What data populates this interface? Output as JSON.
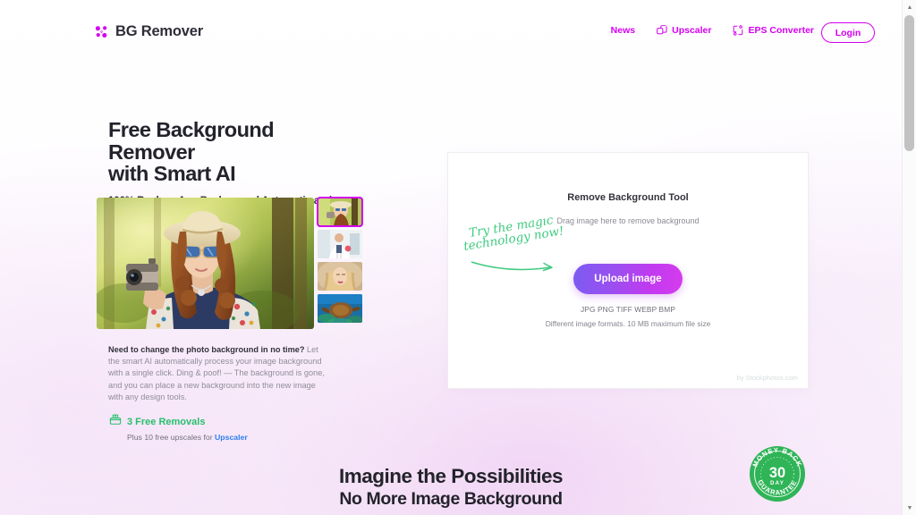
{
  "header": {
    "logo_text": "BG Remover",
    "logo_icon": "scissors-icon",
    "nav": [
      {
        "label": "News",
        "icon": ""
      },
      {
        "label": "Upscaler",
        "icon": "overlapping-squares-icon"
      },
      {
        "label": "EPS Converter",
        "icon": "nodes-icon"
      }
    ],
    "login_label": "Login"
  },
  "hero": {
    "title": "Free Background Remover\nwith Smart AI",
    "subtitle": "100% Replace Any Background Automatic and Free",
    "body_lead": "Need to change the photo background in no time?",
    "body_rest": " Let the smart AI automatically process your image background with a single click. Ding & poof! — The background is gone, and you can place a new background into the new image with any design tools.",
    "free_title": "3 Free Removals",
    "free_sub_prefix": "Plus 10 free upscales for ",
    "free_sub_link": "Upscaler",
    "thumbnails": [
      {
        "name": "thumbnail-woman-camera",
        "selected": true
      },
      {
        "name": "thumbnail-doctor",
        "selected": false
      },
      {
        "name": "thumbnail-blonde-portrait",
        "selected": false
      },
      {
        "name": "thumbnail-sea-turtle",
        "selected": false
      }
    ]
  },
  "upload_panel": {
    "annotation": "Try the magic technology now!",
    "title": "Remove Background Tool",
    "drag_text": "Drag image here to remove background",
    "button_label": "Upload image",
    "formats": "JPG PNG TIFF WEBP BMP",
    "note": "Different image formats. 10 MB maximum file size",
    "credit": "by Stockphotos.com"
  },
  "bottom": {
    "heading": "Imagine the Possibilities",
    "subheading": "No More Image Background",
    "badge": {
      "top_text": "MONEY BACK",
      "number": "30",
      "unit": "DAY",
      "bottom_text": "GUARANTEE"
    }
  },
  "colors": {
    "brand_magenta": "#d400f0",
    "green": "#27c06a",
    "link_blue": "#2f7ff0",
    "dark_text": "#23232b"
  }
}
